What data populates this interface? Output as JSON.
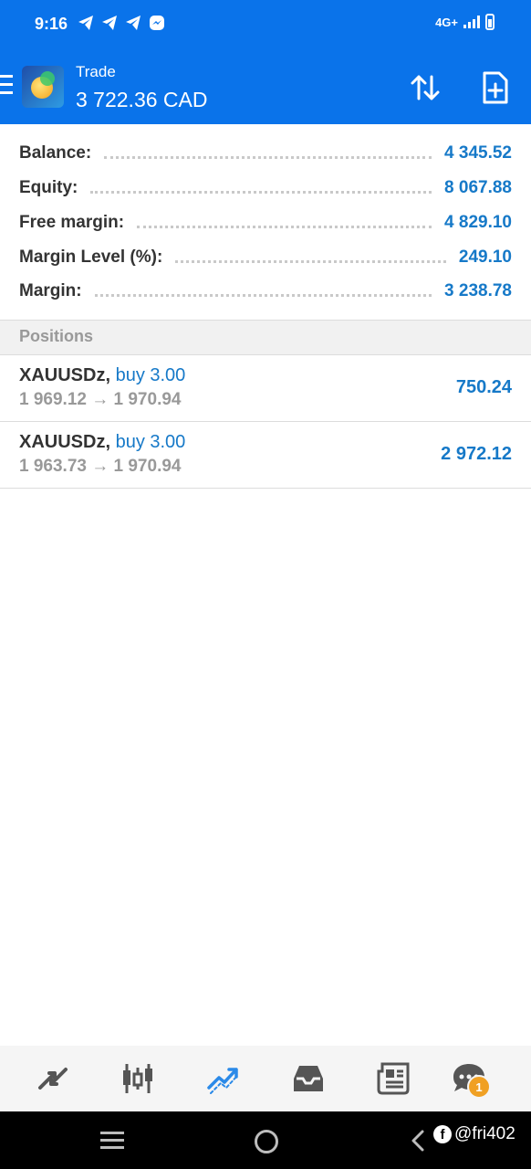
{
  "status_bar": {
    "time": "9:16",
    "network": "4G+",
    "notification_icons": [
      "telegram-icon",
      "telegram-icon",
      "telegram-icon",
      "messenger-icon"
    ]
  },
  "header": {
    "menu_icon": "hamburger-menu-icon",
    "app_icon": "metatrader-icon",
    "title": "Trade",
    "subtitle": "3 722.36 CAD",
    "sort_icon": "sort-arrows-icon",
    "new_order_icon": "new-order-icon"
  },
  "summary": {
    "balance": {
      "label": "Balance:",
      "value": "4 345.52"
    },
    "equity": {
      "label": "Equity:",
      "value": "8 067.88"
    },
    "free_margin": {
      "label": "Free margin:",
      "value": "4 829.10"
    },
    "margin_level": {
      "label": "Margin Level (%):",
      "value": "249.10"
    },
    "margin": {
      "label": "Margin:",
      "value": "3 238.78"
    }
  },
  "positions": {
    "header": "Positions",
    "items": [
      {
        "symbol": "XAUUSDz,",
        "side": "buy 3.00",
        "prices": "1 969.12 → 1 970.94",
        "profit": "750.24"
      },
      {
        "symbol": "XAUUSDz,",
        "side": "buy 3.00",
        "prices": "1 963.73 → 1 970.94",
        "profit": "2 972.12"
      }
    ]
  },
  "bottom_nav": {
    "items": [
      "quotes-icon",
      "chart-icon",
      "trade-icon",
      "history-icon",
      "news-icon",
      "chat-icon"
    ],
    "active": "trade-icon",
    "chat_badge": "1"
  },
  "watermark": "@fri402",
  "colors": {
    "primary": "#0a73ea",
    "value_blue": "#1679c8",
    "muted": "#999999",
    "badge": "#f0a023"
  }
}
